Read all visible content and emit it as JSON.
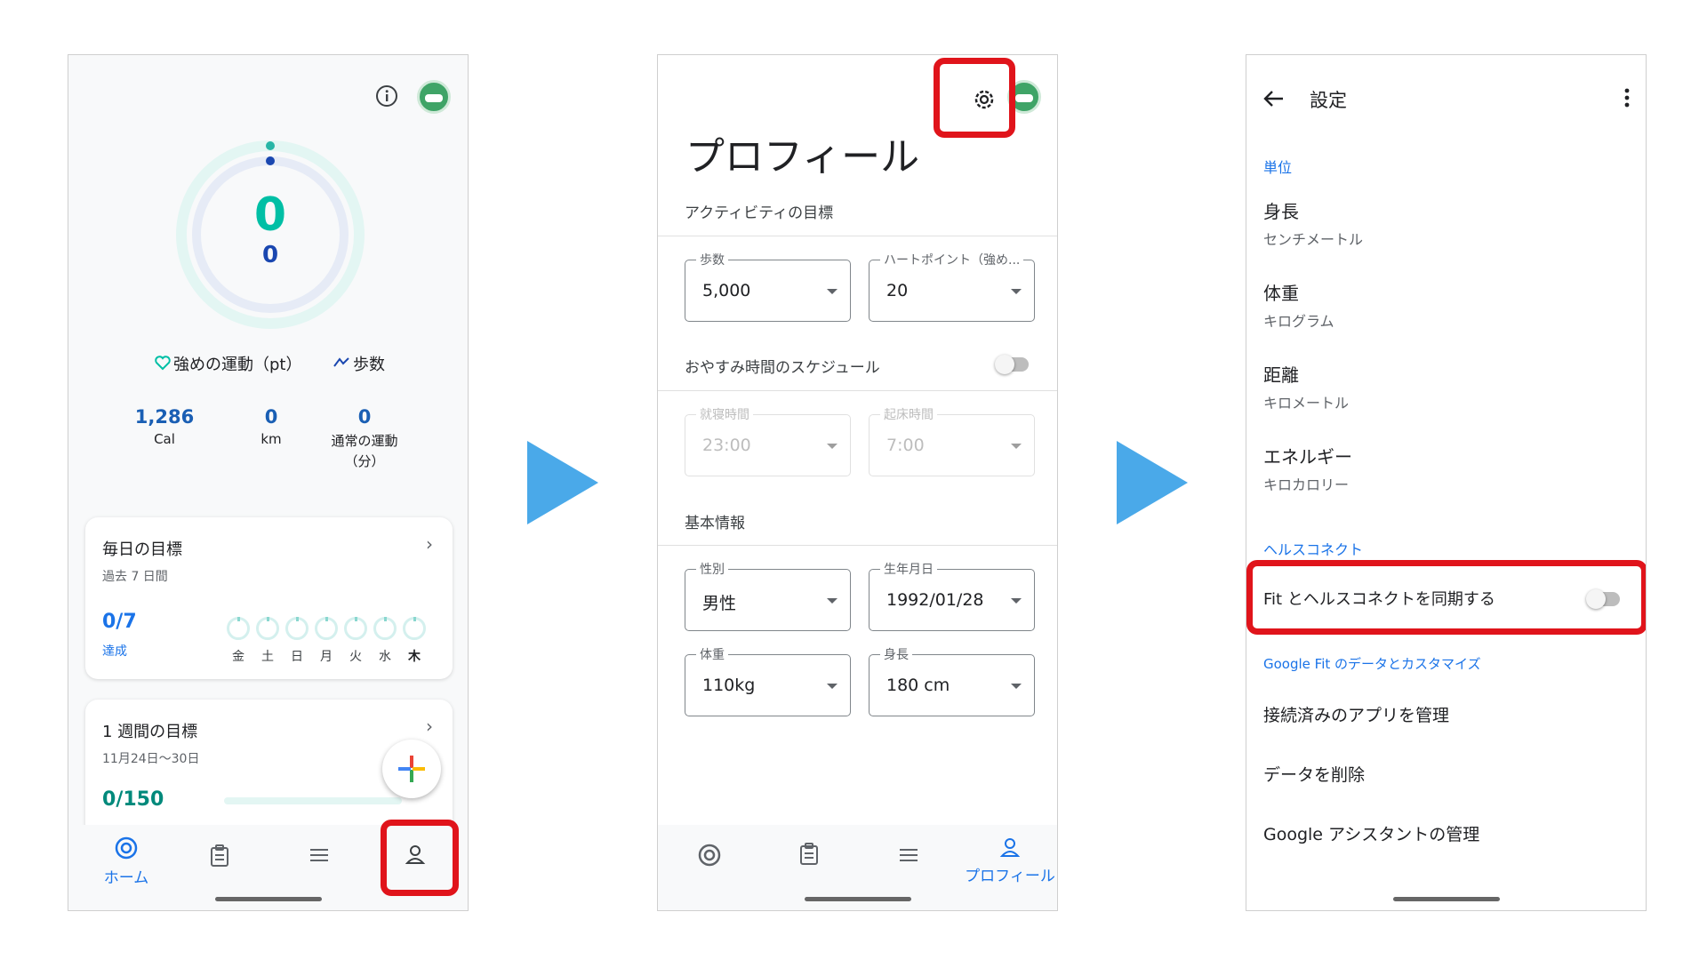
{
  "screen1": {
    "ring": {
      "main_value": "0",
      "sub_value": "0",
      "colors": {
        "teal": "#00bfa5",
        "navy": "#1a47b0"
      }
    },
    "legend": {
      "heart_label": "強めの運動（pt）",
      "steps_label": "歩数"
    },
    "stats": [
      {
        "value": "1,286",
        "unit": "Cal"
      },
      {
        "value": "0",
        "unit": "km"
      },
      {
        "value": "0",
        "unit": "通常の運動",
        "unit2": "（分）"
      }
    ],
    "daily": {
      "title": "毎日の目標",
      "subtitle": "過去 7 日間",
      "value": "0/7",
      "value_label": "達成",
      "days": [
        "金",
        "土",
        "日",
        "月",
        "火",
        "水",
        "木"
      ]
    },
    "weekly": {
      "title": "1 週間の目標",
      "subtitle": "11月24日〜30日",
      "value": "0",
      "value_total": "/150"
    },
    "nav": {
      "home_label": "ホーム"
    }
  },
  "screen2": {
    "title": "プロフィール",
    "activity_section": "アクティビティの目標",
    "steps": {
      "label": "歩数",
      "value": "5,000"
    },
    "heart": {
      "label": "ハートポイント（強め...",
      "value": "20"
    },
    "bedtime_label": "おやすみ時間のスケジュール",
    "sleep": {
      "label": "就寝時間",
      "value": "23:00"
    },
    "wake": {
      "label": "起床時間",
      "value": "7:00"
    },
    "basic_section": "基本情報",
    "gender": {
      "label": "性別",
      "value": "男性"
    },
    "birthday": {
      "label": "生年月日",
      "value": "1992/01/28"
    },
    "weight": {
      "label": "体重",
      "value": "110kg"
    },
    "height": {
      "label": "身長",
      "value": "180 cm"
    },
    "nav": {
      "profile_label": "プロフィール"
    }
  },
  "screen3": {
    "title": "設定",
    "units_section": "単位",
    "items": [
      {
        "label": "身長",
        "value": "センチメートル"
      },
      {
        "label": "体重",
        "value": "キログラム"
      },
      {
        "label": "距離",
        "value": "キロメートル"
      },
      {
        "label": "エネルギー",
        "value": "キロカロリー"
      }
    ],
    "health_section": "ヘルスコネクト",
    "sync_label": "Fit とヘルスコネクトを同期する",
    "fit_section": "Google Fit のデータとカスタマイズ",
    "manage_apps": "接続済みのアプリを管理",
    "delete_data": "データを削除",
    "assistant": "Google アシスタントの管理"
  },
  "colors": {
    "accent": "#1a73e8",
    "highlight": "#e0141b",
    "arrow": "#4aa9e9"
  }
}
